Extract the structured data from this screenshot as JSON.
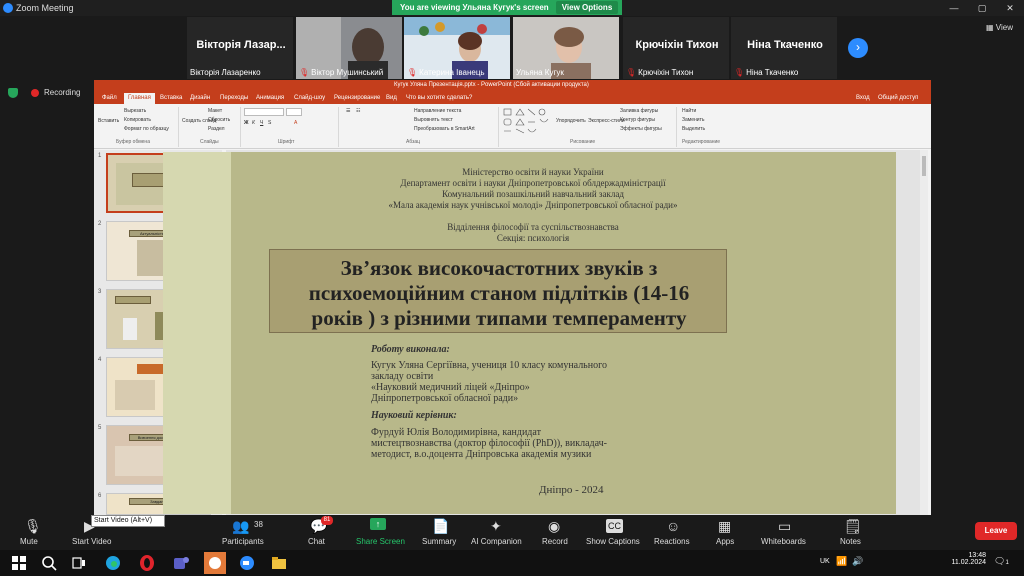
{
  "window": {
    "title": "Zoom Meeting"
  },
  "banner": {
    "text": "You are viewing Ульяна Кугук's screen",
    "view_options": "View Options"
  },
  "gallery": {
    "tiles": [
      {
        "big": "Вікторія Лазар...",
        "label": "Вікторія Лазаренко",
        "muted": false
      },
      {
        "big": "",
        "label": "Віктор Мушинський",
        "muted": true
      },
      {
        "big": "",
        "label": "Катерина Іванець",
        "muted": true
      },
      {
        "big": "",
        "label": "Ульяна Кугук",
        "muted": false
      },
      {
        "big": "Крючіхін Тихон",
        "label": "Крючіхін Тихон",
        "muted": true
      },
      {
        "big": "Ніна Ткаченко",
        "label": "Ніна Ткаченко",
        "muted": true
      }
    ],
    "view_label": "View"
  },
  "recording": "Recording",
  "powerpoint": {
    "title": "Кугук Уляна Презентація.pptx - PowerPoint (Сбой активации продукта)",
    "tabs": [
      "Файл",
      "Главная",
      "Вставка",
      "Дизайн",
      "Переходы",
      "Анимация",
      "Слайд-шоу",
      "Рецензирование",
      "Вид",
      "Что вы хотите сделать?"
    ],
    "right_tabs": [
      "Вход",
      "Общий доступ"
    ],
    "ribbon": {
      "clipboard": {
        "paste": "Вставить",
        "cut": "Вырезать",
        "copy": "Копировать",
        "format": "Формат по образцу",
        "group": "Буфер обмена"
      },
      "slides": {
        "create": "Создать слайд",
        "layout": "Макет",
        "reset": "Сбросить",
        "section": "Раздел",
        "group": "Слайды"
      },
      "font": {
        "group": "Шрифт"
      },
      "paragraph": {
        "direction": "Направление текста",
        "align": "Выровнять текст",
        "smartart": "Преобразовать в SmartArt",
        "group": "Абзац"
      },
      "drawing": {
        "arrange": "Упорядочить",
        "styles": "Экспресс-стили",
        "fill": "Заливка фигуры",
        "outline": "Контур фигуры",
        "effects": "Эффекты фигуры",
        "group": "Рисование"
      },
      "editing": {
        "find": "Найти",
        "replace": "Заменить",
        "select": "Выделить",
        "group": "Редактирование"
      }
    },
    "thumbnails": [
      {
        "num": "1",
        "header": ""
      },
      {
        "num": "2",
        "header": "Актуальність роботи"
      },
      {
        "num": "3",
        "header": ""
      },
      {
        "num": "4",
        "header": ""
      },
      {
        "num": "5",
        "header": "Вивчення дослідження"
      },
      {
        "num": "6",
        "header": "Завдання"
      }
    ],
    "slide": {
      "org_lines": [
        "Міністерство освіти й науки України",
        "Департамент освіти і науки Дніпропетровської облдержадміністрації",
        "Комунальний позашкільний навчальний заклад",
        "«Мала академія наук учнівської молоді» Дніпропетровської обласної ради»"
      ],
      "dept_lines": [
        "Відділення філософії та суспільствознавства",
        "Секція: психологія"
      ],
      "title_lines": [
        "Зв’язок високочастотних звуків з",
        "психоемоційним станом підлітків (14-16",
        "років ) з різними типами темпераменту"
      ],
      "author_label": "Роботу виконала:",
      "author_lines": [
        "Кугук Уляна Сергіївна, учениця 10 класу комунального",
        "закладу освіти",
        "«Науковий медичний ліцей «Дніпро»",
        "Дніпропетровської обласної ради»"
      ],
      "advisor_label": "Науковий керівник:",
      "advisor_lines": [
        "Фурдуй Юлія  Володимирівна, кандидат",
        "мистецтвознавства (доктор філософії (PhD)), викладач-",
        "методист, в.о.доцента Дніпровська академія музики"
      ],
      "footer": "Дніпро - 2024"
    }
  },
  "toolbar": {
    "mute": "Mute",
    "start_video": "Start Video",
    "tooltip": "Start Video (Alt+V)",
    "participants": "Participants",
    "participants_count": "38",
    "chat": "Chat",
    "chat_badge": "81",
    "share_screen": "Share Screen",
    "summary": "Summary",
    "ai_companion": "AI Companion",
    "record": "Record",
    "show_captions": "Show Captions",
    "reactions": "Reactions",
    "apps": "Apps",
    "whiteboards": "Whiteboards",
    "notes": "Notes",
    "leave": "Leave"
  },
  "taskbar": {
    "lang": "UK",
    "time": "13:48",
    "date": "11.02.2024",
    "notif": "1"
  }
}
